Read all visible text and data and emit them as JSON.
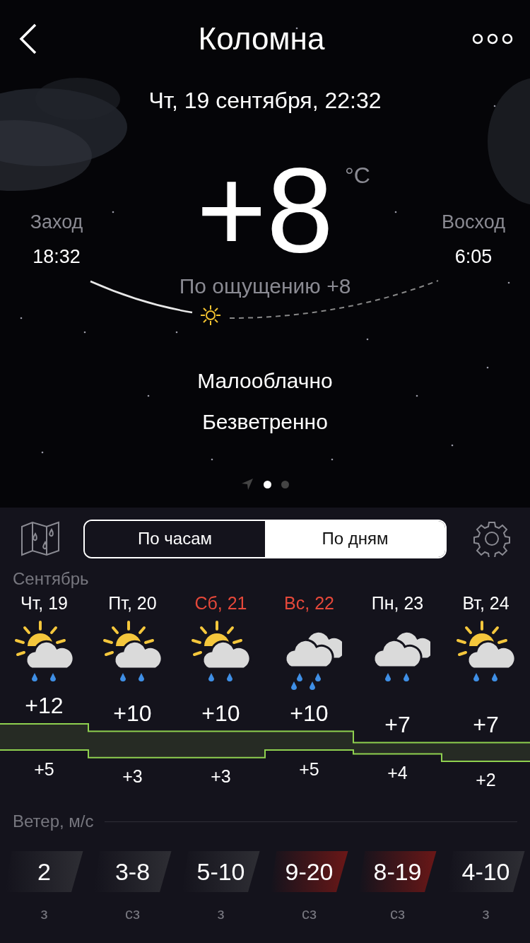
{
  "header": {
    "title": "Коломна"
  },
  "current": {
    "datetime": "Чт, 19 сентября, 22:32",
    "temperature": "+8",
    "unit": "°C",
    "feels_like": "По ощущению +8",
    "condition": "Малооблачно",
    "wind": "Безветренно",
    "sunset": {
      "label": "Заход",
      "time": "18:32"
    },
    "sunrise": {
      "label": "Восход",
      "time": "6:05"
    }
  },
  "pages": [
    {
      "kind": "location",
      "selected": false
    },
    {
      "kind": "dot",
      "selected": true
    },
    {
      "kind": "dot",
      "selected": false
    }
  ],
  "tabs": [
    {
      "label": "По часам",
      "selected": false
    },
    {
      "label": "По дням",
      "selected": true
    }
  ],
  "month": "Сентябрь",
  "days": [
    {
      "label": "Чт, 19",
      "weekend": false,
      "kind": "sun_cloud_rain",
      "high": "+12",
      "low": "+5",
      "wind": "2",
      "strong_wind": false,
      "direction": "з"
    },
    {
      "label": "Пт, 20",
      "weekend": false,
      "kind": "sun_cloud_rain",
      "high": "+10",
      "low": "+3",
      "wind": "3-8",
      "strong_wind": false,
      "direction": "сз"
    },
    {
      "label": "Сб, 21",
      "weekend": true,
      "kind": "sun_cloud_rain",
      "high": "+10",
      "low": "+3",
      "wind": "5-10",
      "strong_wind": false,
      "direction": "з"
    },
    {
      "label": "Вс, 22",
      "weekend": true,
      "kind": "clouds_heavy_rain",
      "high": "+10",
      "low": "+5",
      "wind": "9-20",
      "strong_wind": true,
      "direction": "сз"
    },
    {
      "label": "Пн, 23",
      "weekend": false,
      "kind": "clouds_rain",
      "high": "+7",
      "low": "+4",
      "wind": "8-19",
      "strong_wind": true,
      "direction": "сз"
    },
    {
      "label": "Вт, 24",
      "weekend": false,
      "kind": "sun_cloud_rain",
      "high": "+7",
      "low": "+2",
      "wind": "4-10",
      "strong_wind": false,
      "direction": "з"
    }
  ],
  "wind_title": "Ветер, м/с"
}
